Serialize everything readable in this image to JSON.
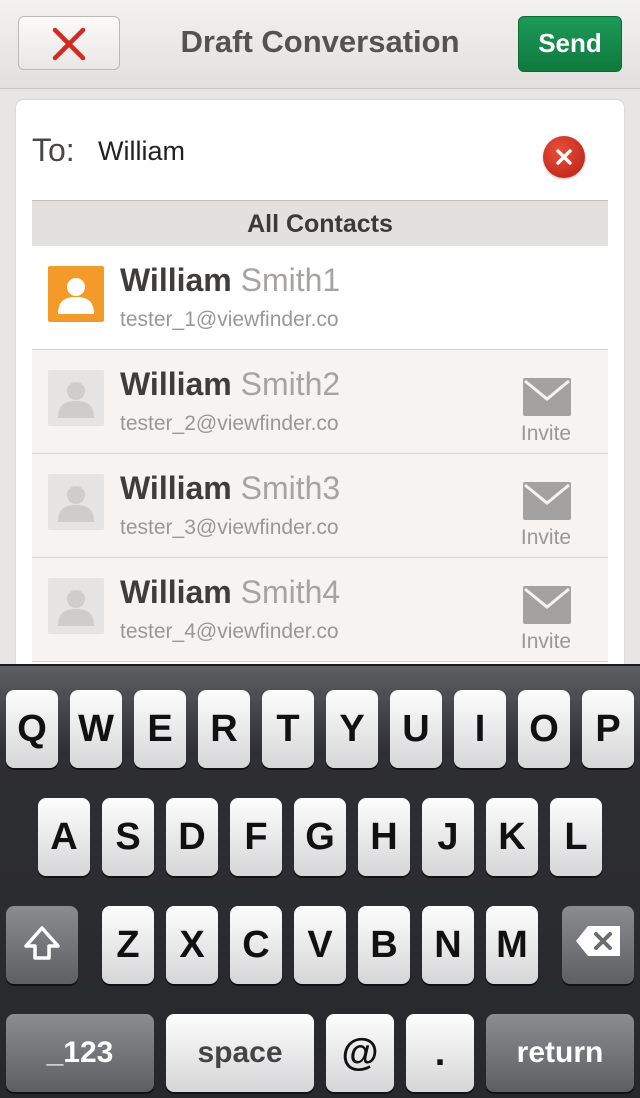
{
  "header": {
    "title": "Draft Conversation",
    "send_label": "Send",
    "cancel_icon": "close-icon"
  },
  "to_field": {
    "label": "To:",
    "value": "William",
    "clear_icon": "clear-icon"
  },
  "section_header": "All Contacts",
  "contacts": [
    {
      "first": "William",
      "last": "Smith1",
      "email": "tester_1@viewfinder.co",
      "active": true,
      "invite": false
    },
    {
      "first": "William",
      "last": "Smith2",
      "email": "tester_2@viewfinder.co",
      "active": false,
      "invite": true
    },
    {
      "first": "William",
      "last": "Smith3",
      "email": "tester_3@viewfinder.co",
      "active": false,
      "invite": true
    },
    {
      "first": "William",
      "last": "Smith4",
      "email": "tester_4@viewfinder.co",
      "active": false,
      "invite": true
    }
  ],
  "invite_label": "Invite",
  "keyboard": {
    "row1": [
      "Q",
      "W",
      "E",
      "R",
      "T",
      "Y",
      "U",
      "I",
      "O",
      "P"
    ],
    "row2": [
      "A",
      "S",
      "D",
      "F",
      "G",
      "H",
      "J",
      "K",
      "L"
    ],
    "row3": [
      "Z",
      "X",
      "C",
      "V",
      "B",
      "N",
      "M"
    ],
    "numbers": "_123",
    "space": "space",
    "at": "@",
    "dot": ".",
    "return": "return"
  },
  "colors": {
    "send": "#138a48",
    "avatar_active": "#f39a28",
    "clear": "#c8281d"
  }
}
